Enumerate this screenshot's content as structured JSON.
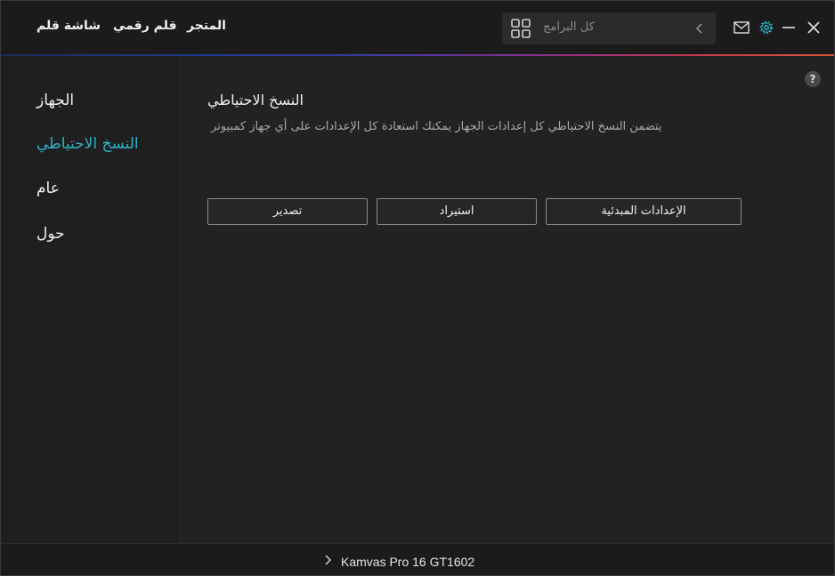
{
  "header": {
    "tabs": {
      "pen_display": "شاشة قلم",
      "digital_pen": "قلم رقمي",
      "store": "المتجر"
    },
    "search": {
      "placeholder": "كل البرامج",
      "grid_icon": "grid-icon",
      "nav_icon": "chevron-left-icon"
    },
    "window_controls": [
      "mail-icon",
      "gear-icon",
      "minimize-icon",
      "close-icon"
    ],
    "accent_color": "#2fb2c8"
  },
  "sidebar": {
    "items": [
      {
        "label": "الجهاز",
        "active": false
      },
      {
        "label": "النسخ الاحتياطي",
        "active": true
      },
      {
        "label": "عام",
        "active": false
      },
      {
        "label": "حول",
        "active": false
      }
    ]
  },
  "main": {
    "help_label": "?",
    "title": "النسخ الاحتياطي",
    "description": "يتضمن النسخ الاحتياطي كل إعدادات الجهاز يمكنك استعادة كل الإعدادات على أي جهاز كمبيوتر",
    "buttons": {
      "export": "تصدير",
      "import": "استيراد",
      "defaults": "الإعدادات المبدئية"
    }
  },
  "footer": {
    "device_name": "Kamvas Pro 16 GT1602"
  }
}
